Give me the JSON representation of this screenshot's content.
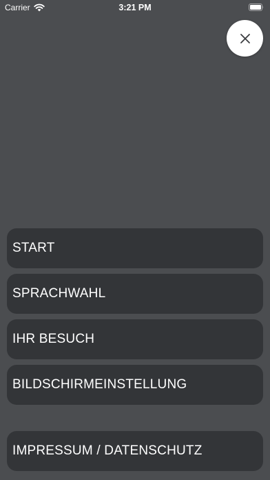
{
  "status_bar": {
    "carrier": "Carrier",
    "time": "3:21 PM"
  },
  "close_button": {
    "icon": "close-icon"
  },
  "menu": {
    "items": [
      {
        "label": "START"
      },
      {
        "label": "SPRACHWAHL"
      },
      {
        "label": "IHR BESUCH"
      },
      {
        "label": "BILDSCHIRMEINSTELLUNG"
      },
      {
        "label": "IMPRESSUM / DATENSCHUTZ"
      }
    ]
  },
  "colors": {
    "background": "#4b4d50",
    "menu_item_background": "#333538",
    "text": "#ffffff",
    "close_button_background": "#ffffff"
  }
}
